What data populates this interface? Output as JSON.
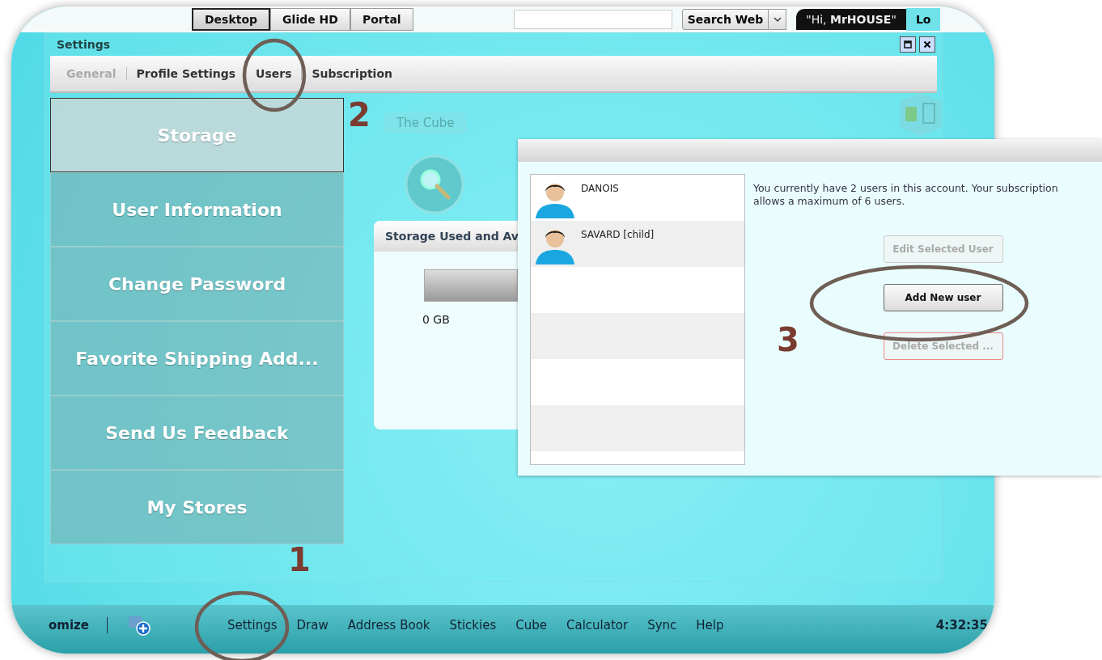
{
  "top_bar": {
    "tabs": [
      {
        "label": "Desktop",
        "selected": true
      },
      {
        "label": "Glide HD",
        "selected": false
      },
      {
        "label": "Portal",
        "selected": false
      }
    ],
    "search_button": "Search Web",
    "greeting": "\"Hi, **MrHOUSE**\"",
    "logout_tab": "Lo"
  },
  "settings_window": {
    "title": "Settings",
    "tabs": [
      {
        "label": "General",
        "disabled": true
      },
      {
        "label": "Profile Settings",
        "disabled": false
      },
      {
        "label": "Users",
        "disabled": false
      },
      {
        "label": "Subscription",
        "disabled": false
      }
    ],
    "menu": [
      {
        "label": "Storage",
        "selected": true
      },
      {
        "label": "User Information",
        "selected": false
      },
      {
        "label": "Change Password",
        "selected": false
      },
      {
        "label": "Favorite Shipping Add...",
        "selected": false
      },
      {
        "label": "Send Us Feedback",
        "selected": false
      },
      {
        "label": "My Stores",
        "selected": false
      }
    ],
    "desktop_label": "The Cube",
    "storage_panel": {
      "title": "Storage Used and Av",
      "reading": "0 GB"
    }
  },
  "users_panel": {
    "message": "You currently have 2 users in this account. Your subscription allows a maximum of 6 users.",
    "users": [
      {
        "name": "DANOIS"
      },
      {
        "name": "SAVARD [child]"
      }
    ],
    "buttons": [
      {
        "label": "Edit Selected User",
        "kind": "normal",
        "disabled": true
      },
      {
        "label": "Add New user",
        "kind": "normal",
        "disabled": false
      },
      {
        "label": "Delete Selected ...",
        "kind": "danger",
        "disabled": true
      }
    ]
  },
  "taskbar": {
    "customize": "omize",
    "items": [
      "Settings",
      "Draw",
      "Address Book",
      "Stickies",
      "Cube",
      "Calculator",
      "Sync",
      "Help"
    ],
    "clock": "4:32:35"
  },
  "annotations": [
    {
      "number": "1"
    },
    {
      "number": "2"
    },
    {
      "number": "3"
    }
  ]
}
